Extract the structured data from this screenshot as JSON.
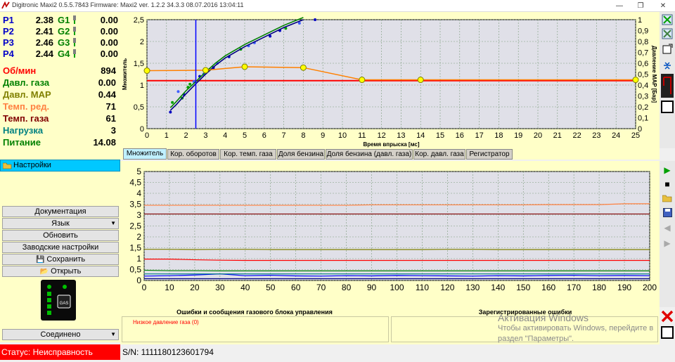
{
  "window": {
    "title": "Digitronic Maxi2 0.5.5.7843 Firmware: Maxi2  ver. 1.2.2  34.3.3   08.07.2016 13:04:11"
  },
  "pressures": [
    {
      "p": "P1",
      "pv": "2.38",
      "g": "G1",
      "gv": "0.00"
    },
    {
      "p": "P2",
      "pv": "2.41",
      "g": "G2",
      "gv": "0.00"
    },
    {
      "p": "P3",
      "pv": "2.46",
      "g": "G3",
      "gv": "0.00"
    },
    {
      "p": "P4",
      "pv": "2.44",
      "g": "G4",
      "gv": "0.00"
    }
  ],
  "stats": [
    {
      "label": "Об/мин",
      "value": "894",
      "color": "#ff0000"
    },
    {
      "label": "Давл. газа",
      "value": "0.00",
      "color": "#008000"
    },
    {
      "label": "Давл. MAP",
      "value": "0.44",
      "color": "#808000"
    },
    {
      "label": "Темп. ред.",
      "value": "71",
      "color": "#ff8040"
    },
    {
      "label": "Темп. газа",
      "value": "61",
      "color": "#800000"
    },
    {
      "label": "Нагрузка",
      "value": "3",
      "color": "#008080"
    },
    {
      "label": "Питание",
      "value": "14.08",
      "color": "#008000"
    }
  ],
  "settings_label": "Настройки",
  "buttons": {
    "docs": "Документация",
    "lang": "Язык",
    "update": "Обновить",
    "factory": "Заводские настройки",
    "save": "Сохранить",
    "open": "Открыть",
    "connected": "Соединено"
  },
  "device_label": "GAS",
  "tabs": [
    "Множитель",
    "Кор. оборотов",
    "Кор. темп. газа",
    "Доля бензина",
    "Доля бензина (давл. газа)",
    "Кор. давл. газа",
    "Регистратор"
  ],
  "errors": {
    "left_title": "Ошибки и сообщения газового блока управления",
    "right_title": "Зарегистрированные ошибки",
    "items": [
      "Низкое давление газа (0)"
    ]
  },
  "watermark": {
    "line1": "Активация Windows",
    "line2": "Чтобы активировать Windows, перейдите в",
    "line3": "раздел \"Параметры\"."
  },
  "status": {
    "text": "Статус: Неисправность",
    "sn": "S/N: 1111180123601794"
  },
  "chart_data": [
    {
      "type": "scatter",
      "xlabel": "Время впрыска [мс]",
      "ylabel": "Множитель",
      "y2label": "Давление MAP [Бар]",
      "xlim": [
        0,
        25
      ],
      "ylim": [
        0,
        2.5
      ],
      "y2lim": [
        0,
        1
      ],
      "xticks": [
        "0",
        "1",
        "2",
        "3",
        "4",
        "5",
        "6",
        "7",
        "8",
        "9",
        "10",
        "11",
        "12",
        "13",
        "14",
        "15",
        "16",
        "17",
        "18",
        "19",
        "20",
        "21",
        "22",
        "23",
        "24",
        "25"
      ],
      "yticks": [
        "0",
        "0,5",
        "1",
        "1,5",
        "2",
        "2,5"
      ],
      "y2ticks": [
        "0",
        "0,1",
        "0,2",
        "0,3",
        "0,4",
        "0,5",
        "0,6",
        "0,7",
        "0,8",
        "0,9",
        "1"
      ],
      "multiplier_curve": {
        "x": [
          0,
          3,
          5,
          8,
          11,
          14,
          25
        ],
        "y": [
          1.33,
          1.34,
          1.42,
          1.4,
          1.12,
          1.12,
          1.12
        ],
        "color": "#ff8000"
      },
      "red_line": {
        "y": 1.1,
        "color": "#ff0000"
      },
      "cursor_x": 2.5,
      "fit_curves": [
        {
          "x": [
            1.2,
            1.5,
            2,
            2.5,
            3,
            3.5,
            4,
            5,
            6,
            7,
            8
          ],
          "y": [
            0.42,
            0.55,
            0.8,
            1.03,
            1.25,
            1.45,
            1.62,
            1.88,
            2.1,
            2.32,
            2.5
          ],
          "color": "#000080"
        },
        {
          "x": [
            1.2,
            1.5,
            2,
            2.5,
            3,
            3.5,
            4,
            5,
            6,
            7,
            8
          ],
          "y": [
            0.48,
            0.62,
            0.87,
            1.08,
            1.3,
            1.5,
            1.67,
            1.93,
            2.15,
            2.37,
            2.55
          ],
          "color": "#008000"
        }
      ],
      "points": [
        [
          1.2,
          0.38
        ],
        [
          1.3,
          0.6
        ],
        [
          1.6,
          0.85
        ],
        [
          1.9,
          0.78
        ],
        [
          2.1,
          0.95
        ],
        [
          2.4,
          1.08
        ],
        [
          2.7,
          1.2
        ],
        [
          3.2,
          1.35
        ],
        [
          3.6,
          1.5
        ],
        [
          4.2,
          1.65
        ],
        [
          4.8,
          1.82
        ],
        [
          5.5,
          1.97
        ],
        [
          6.3,
          2.12
        ],
        [
          7.1,
          2.3
        ],
        [
          7.8,
          2.42
        ],
        [
          8.6,
          2.5
        ],
        [
          2.2,
          1.02
        ],
        [
          2.9,
          1.25
        ],
        [
          3.4,
          1.4
        ],
        [
          1.8,
          0.7
        ],
        [
          5.2,
          1.9
        ],
        [
          6.8,
          2.25
        ]
      ]
    },
    {
      "type": "line",
      "xlim": [
        0,
        200
      ],
      "ylim": [
        0,
        5
      ],
      "xticks": [
        "0",
        "10",
        "20",
        "30",
        "40",
        "50",
        "60",
        "70",
        "80",
        "90",
        "100",
        "110",
        "120",
        "130",
        "140",
        "150",
        "160",
        "170",
        "180",
        "190",
        "200"
      ],
      "yticks": [
        "0",
        "0,5",
        "1",
        "1,5",
        "2",
        "2,5",
        "3",
        "3,5",
        "4",
        "4,5",
        "5"
      ],
      "series": [
        {
          "values": [
            3.45,
            3.45,
            3.45,
            3.45,
            3.45,
            3.45,
            3.45,
            3.45,
            3.45,
            3.47,
            3.47,
            3.47,
            3.47,
            3.47,
            3.47,
            3.47,
            3.48,
            3.48,
            3.48,
            3.52,
            3.52
          ],
          "color": "#ff8040"
        },
        {
          "values": [
            3.05,
            3.05,
            3.05,
            3.05,
            3.05,
            3.05,
            3.05,
            3.05,
            3.05,
            3.05,
            3.05,
            3.05,
            3.05,
            3.05,
            3.05,
            3.05,
            3.05,
            3.05,
            3.05,
            3.05,
            3.05
          ],
          "color": "#800000"
        },
        {
          "values": [
            1.43,
            1.43,
            1.42,
            1.43,
            1.43,
            1.42,
            1.42,
            1.42,
            1.42,
            1.42,
            1.42,
            1.42,
            1.43,
            1.43,
            1.42,
            1.42,
            1.42,
            1.42,
            1.42,
            1.42,
            1.42
          ],
          "color": "#808000"
        },
        {
          "values": [
            0.98,
            0.98,
            0.95,
            0.93,
            0.92,
            0.92,
            0.92,
            0.92,
            0.92,
            0.92,
            0.92,
            0.92,
            0.92,
            0.92,
            0.92,
            0.92,
            0.92,
            0.92,
            0.92,
            0.92,
            0.92
          ],
          "color": "#ff0000"
        },
        {
          "values": [
            0.47,
            0.45,
            0.45,
            0.44,
            0.44,
            0.44,
            0.44,
            0.44,
            0.44,
            0.44,
            0.44,
            0.44,
            0.44,
            0.44,
            0.44,
            0.44,
            0.44,
            0.44,
            0.44,
            0.44,
            0.44
          ],
          "color": "#008000"
        },
        {
          "values": [
            0.2,
            0.22,
            0.25,
            0.3,
            0.22,
            0.24,
            0.21,
            0.2,
            0.22,
            0.21,
            0.23,
            0.22,
            0.21,
            0.2,
            0.22,
            0.21,
            0.23,
            0.24,
            0.22,
            0.23,
            0.22
          ],
          "color": "#0000ff"
        },
        {
          "values": [
            0.3,
            0.3,
            0.3,
            0.3,
            0.3,
            0.3,
            0.3,
            0.3,
            0.3,
            0.3,
            0.3,
            0.3,
            0.3,
            0.3,
            0.3,
            0.3,
            0.3,
            0.3,
            0.3,
            0.3,
            0.3
          ],
          "color": "#008080"
        },
        {
          "values": [
            0.08,
            0.08,
            0.08,
            0.08,
            0.08,
            0.08,
            0.08,
            0.08,
            0.08,
            0.08,
            0.08,
            0.08,
            0.08,
            0.08,
            0.08,
            0.08,
            0.08,
            0.08,
            0.08,
            0.08,
            0.08
          ],
          "color": "#000080"
        }
      ]
    }
  ]
}
